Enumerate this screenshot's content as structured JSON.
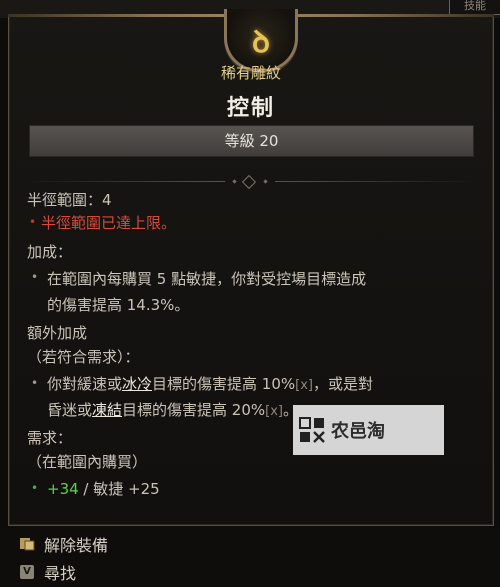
{
  "top_tab": {
    "label": "技能"
  },
  "item": {
    "emblem_icon": "glyph-rune-icon",
    "rarity": "稀有雕紋",
    "name": "控制",
    "level_label": "等級 20"
  },
  "stats": {
    "radius_label": "半徑範圍：4",
    "radius_max_note": "半徑範圍已達上限。",
    "bonus_header": "加成：",
    "bonus_line1": "在範圍內每購買 5 點敏捷，你對受控場目標造成",
    "bonus_line2": "的傷害提高 14.3%。",
    "extra_header": "額外加成",
    "extra_condition": "（若符合需求）：",
    "extra_line1_a": "你對緩速或",
    "extra_line1_ice": "冰冷",
    "extra_line1_b": "目標的傷害提高 10%",
    "extra_line1_x": "[x]",
    "extra_line1_c": "，或是對",
    "extra_line2_a": "昏迷或",
    "extra_line2_freeze": "凍結",
    "extra_line2_b": "目標的傷害提高 20%",
    "extra_line2_x": "[x]",
    "extra_line2_c": "。",
    "req_header": "需求：",
    "req_condition": "（在範圍內購買）",
    "req_value": "+34",
    "req_sep": " / 敏捷 +25"
  },
  "watermark": {
    "text": "农邑淘"
  },
  "footer": {
    "unequip_label": "解除裝備",
    "unequip_icon": "unequip-icon",
    "find_key": "V",
    "find_label": "尋找"
  },
  "colors": {
    "rarity_gold": "#e4d08a",
    "warning_red": "#d74b3c",
    "value_green": "#5fcf4b"
  }
}
